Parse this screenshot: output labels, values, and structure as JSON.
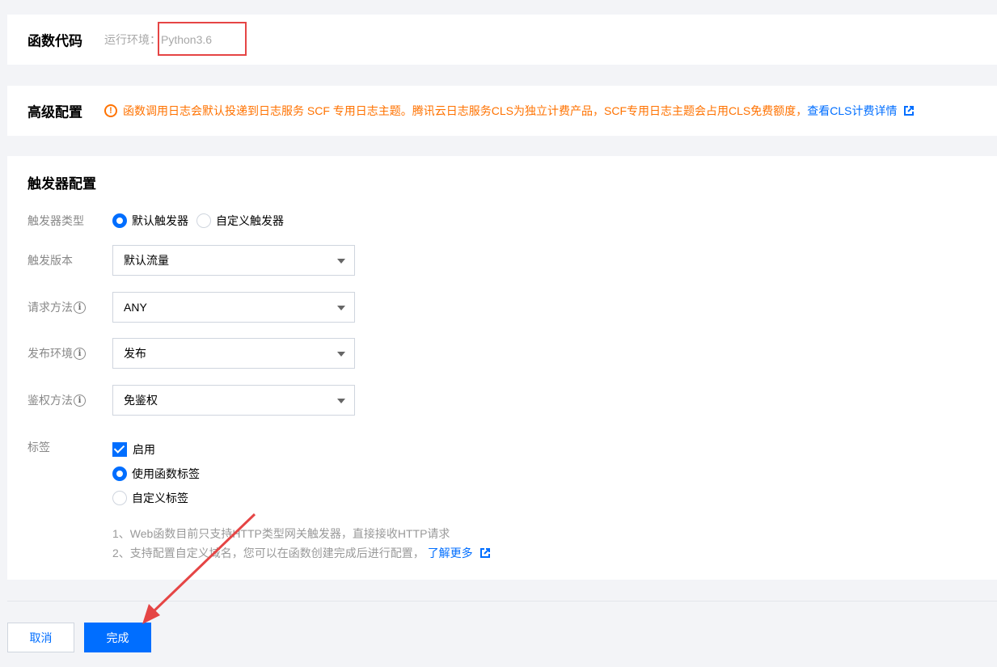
{
  "code_section": {
    "title": "函数代码",
    "runtime_label": "运行环境：",
    "runtime_value": "Python3.6"
  },
  "advanced_section": {
    "title": "高级配置",
    "notice": "函数调用日志会默认投递到日志服务 SCF 专用日志主题。腾讯云日志服务CLS为独立计费产品，SCF专用日志主题会占用CLS免费额度，",
    "notice_link": "查看CLS计费详情"
  },
  "trigger_section": {
    "title": "触发器配置",
    "trigger_type": {
      "label": "触发器类型",
      "options": [
        "默认触发器",
        "自定义触发器"
      ],
      "selected": "默认触发器"
    },
    "trigger_version": {
      "label": "触发版本",
      "value": "默认流量"
    },
    "request_method": {
      "label": "请求方法",
      "value": "ANY"
    },
    "publish_env": {
      "label": "发布环境",
      "value": "发布"
    },
    "auth_method": {
      "label": "鉴权方法",
      "value": "免鉴权"
    },
    "tags": {
      "label": "标签",
      "enable_label": "启用",
      "enabled": true,
      "options": [
        "使用函数标签",
        "自定义标签"
      ],
      "selected": "使用函数标签"
    },
    "notes": {
      "line1": "1、Web函数目前只支持HTTP类型网关触发器，直接接收HTTP请求",
      "line2": "2、支持配置自定义域名，您可以在函数创建完成后进行配置，",
      "line2_link": "了解更多"
    }
  },
  "footer": {
    "cancel_label": "取消",
    "done_label": "完成"
  },
  "colors": {
    "primary": "#006eff",
    "warning": "#ff7200",
    "annotation_red": "#e54545"
  },
  "icons": [
    "info-icon",
    "warning-icon",
    "external-link-icon",
    "chevron-down-icon",
    "check-icon"
  ]
}
